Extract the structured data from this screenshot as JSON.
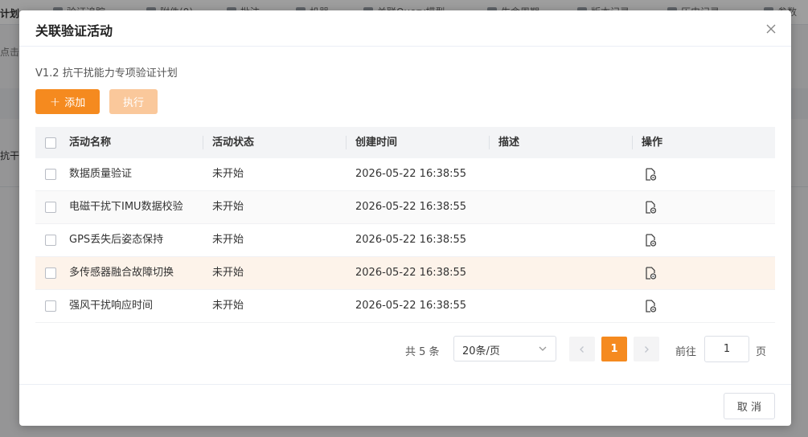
{
  "background": {
    "left_title": "计划",
    "side_text_1": "点击",
    "side_text_2": "抗干",
    "toolbar_tabs": [
      {
        "label": "验证追踪",
        "icon": "grid-icon"
      },
      {
        "label": "附件(0)",
        "icon": "paperclip-icon"
      },
      {
        "label": "批注",
        "icon": "comment-icon"
      },
      {
        "label": "机器",
        "icon": "user-icon"
      },
      {
        "label": "关联Query模型",
        "icon": "link-icon"
      },
      {
        "label": "生命周期",
        "icon": "cycle-icon"
      },
      {
        "label": "版本记录",
        "icon": "document-icon"
      },
      {
        "label": "历史记录",
        "icon": "history-icon"
      },
      {
        "label": "参数",
        "icon": "settings-icon"
      }
    ]
  },
  "dialog": {
    "title": "关联验证活动",
    "plan_name": "V1.2 抗干扰能力专项验证计划",
    "add_label": "添加",
    "execute_label": "执行",
    "cancel_label": "取 消"
  },
  "table": {
    "columns": [
      "活动名称",
      "活动状态",
      "创建时间",
      "描述",
      "操作"
    ],
    "rows": [
      {
        "name": "数据质量验证",
        "status": "未开始",
        "created": "2026-05-22 16:38:55",
        "desc": ""
      },
      {
        "name": "电磁干扰下IMU数据校验",
        "status": "未开始",
        "created": "2026-05-22 16:38:55",
        "desc": ""
      },
      {
        "name": "GPS丢失后姿态保持",
        "status": "未开始",
        "created": "2026-05-22 16:38:55",
        "desc": ""
      },
      {
        "name": "多传感器融合故障切换",
        "status": "未开始",
        "created": "2026-05-22 16:38:55",
        "desc": ""
      },
      {
        "name": "强风干扰响应时间",
        "status": "未开始",
        "created": "2026-05-22 16:38:55",
        "desc": ""
      }
    ]
  },
  "pagination": {
    "total": "共 5 条",
    "page_size": "20条/页",
    "current": "1",
    "goto_label": "前往",
    "goto_value": "1",
    "page_unit": "页"
  },
  "colors": {
    "accent": "#f58a1f",
    "accent_disabled": "#fac89b",
    "row_hover": "#fdf3ea"
  }
}
